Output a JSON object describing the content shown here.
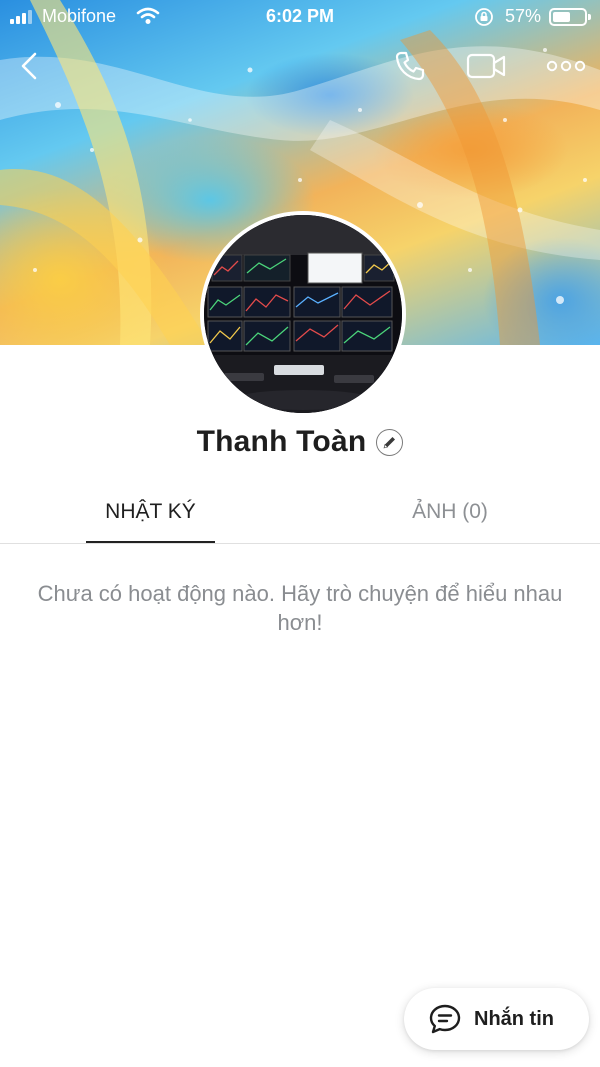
{
  "status_bar": {
    "carrier": "Mobifone",
    "time": "6:02 PM",
    "battery_percent": "57%",
    "battery_level": 0.57,
    "signal_bars": 4
  },
  "toolbar": {
    "back_icon": "chevron-left-icon",
    "call_icon": "phone-icon",
    "video_icon": "video-camera-icon",
    "more_icon": "more-horizontal-icon"
  },
  "profile": {
    "name": "Thanh Toàn",
    "edit_icon": "pencil-icon"
  },
  "tabs": [
    {
      "label": "NHẬT KÝ",
      "active": true
    },
    {
      "label": "ẢNH (0)",
      "active": false
    }
  ],
  "empty_state": {
    "message": "Chưa có hoạt động nào. Hãy trò chuyện để hiểu nhau hơn!"
  },
  "message_button": {
    "label": "Nhắn tin",
    "icon": "chat-bubble-icon"
  },
  "colors": {
    "text_primary": "#1e1e1e",
    "text_muted": "#8a8d91",
    "tab_inactive": "#8d9094",
    "divider": "#e0e0e0"
  }
}
